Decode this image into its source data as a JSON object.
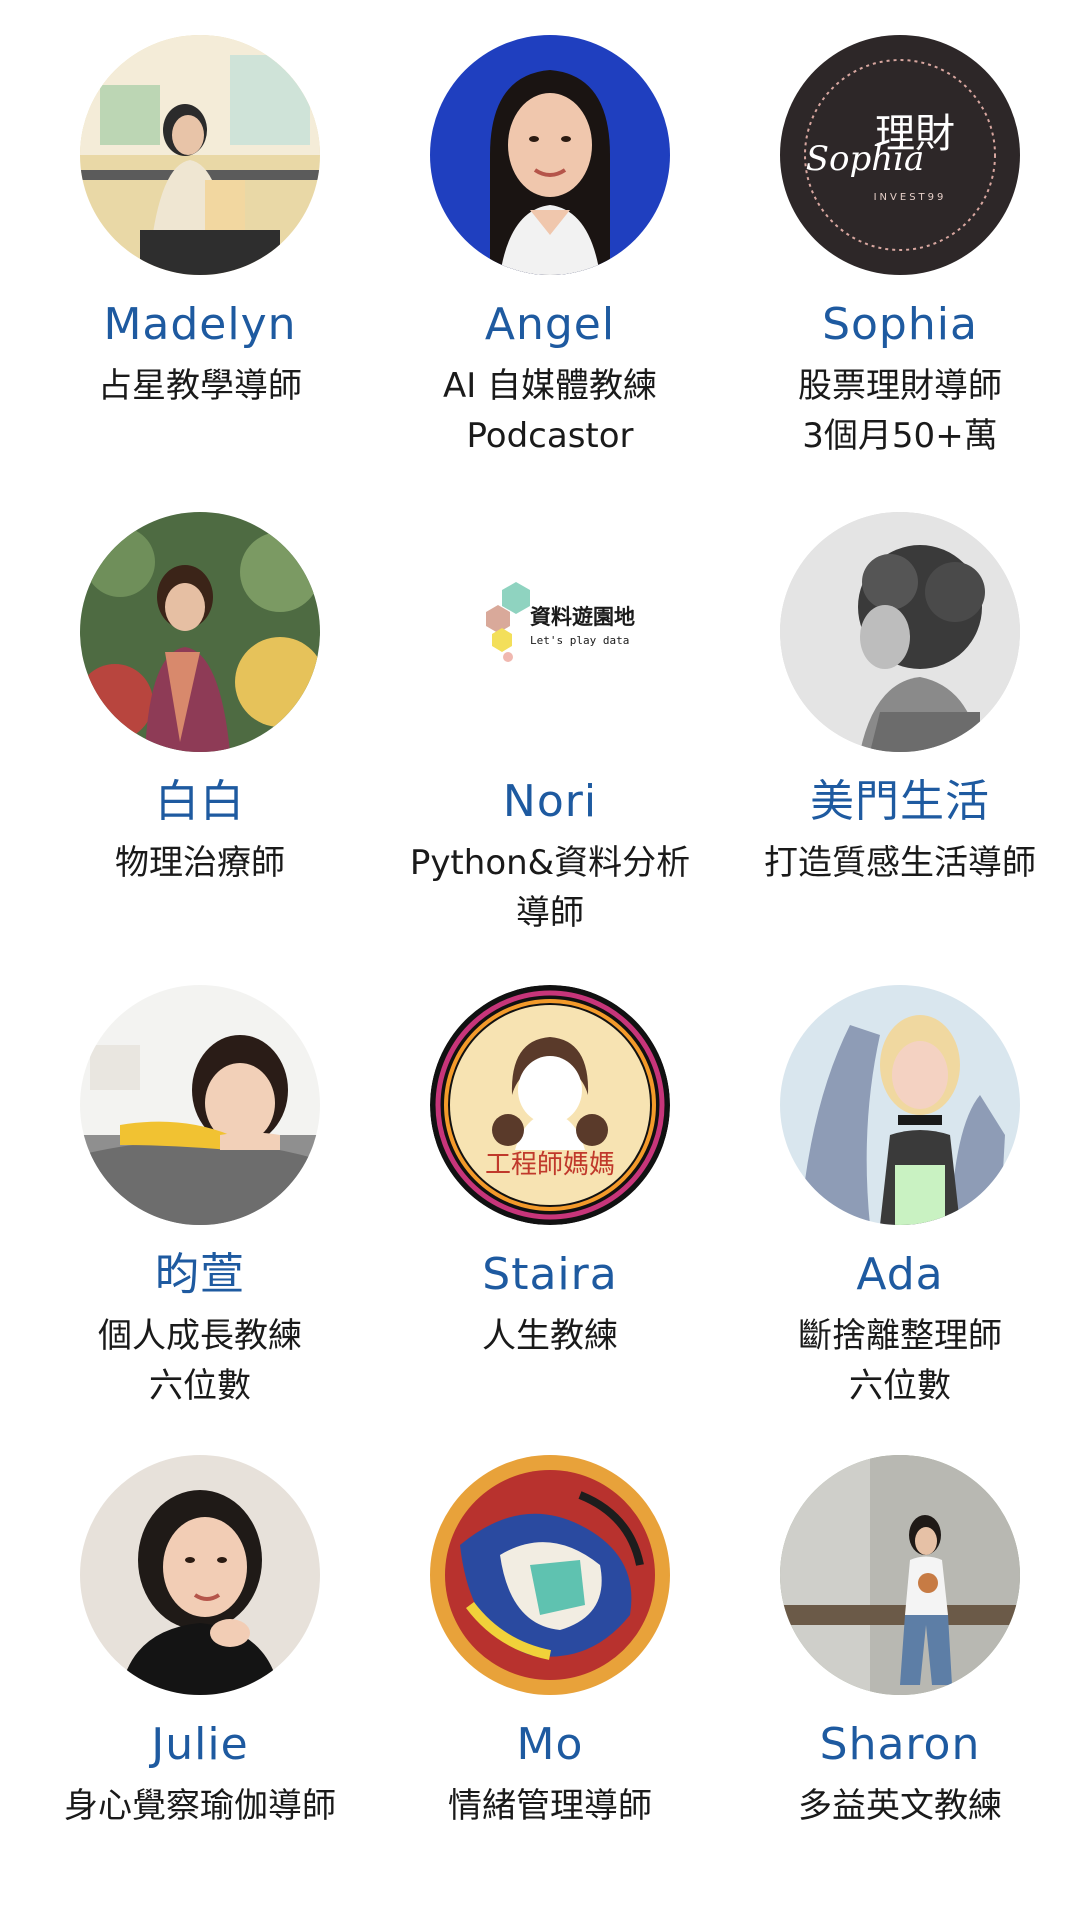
{
  "people": [
    {
      "name": "Madelyn",
      "lines": [
        "占星教學導師"
      ]
    },
    {
      "name": "Angel",
      "lines": [
        "AI 自媒體教練",
        "Podcastor"
      ]
    },
    {
      "name": "Sophia",
      "lines": [
        "股票理財導師",
        "3個月50+萬"
      ],
      "logo_text": [
        "Sophia",
        "理財",
        "INVEST99"
      ]
    },
    {
      "name": "白白",
      "lines": [
        "物理治療師"
      ]
    },
    {
      "name": "Nori",
      "lines": [
        "Python&資料分析",
        "導師"
      ],
      "logo_text": [
        "資料遊園地",
        "Let's play data"
      ]
    },
    {
      "name": "美門生活",
      "lines": [
        "打造質感生活導師"
      ]
    },
    {
      "name": "昀萱",
      "lines": [
        "個人成長教練",
        "六位數"
      ]
    },
    {
      "name": "Staira",
      "lines": [
        "人生教練"
      ],
      "logo_text": [
        "工程師媽媽"
      ]
    },
    {
      "name": "Ada",
      "lines": [
        "斷捨離整理師",
        "六位數"
      ]
    },
    {
      "name": "Julie",
      "lines": [
        "身心覺察瑜伽導師"
      ]
    },
    {
      "name": "Mo",
      "lines": [
        "情緒管理導師"
      ]
    },
    {
      "name": "Sharon",
      "lines": [
        "多益英文教練"
      ]
    }
  ],
  "colors": {
    "name_text": "#1e5aa0",
    "desc_text": "#1a1a1a",
    "background": "#ffffff"
  }
}
